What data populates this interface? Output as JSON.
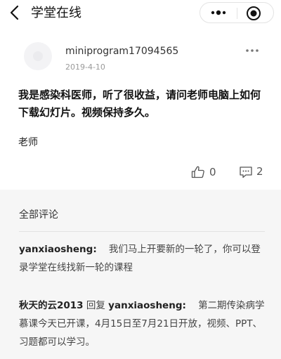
{
  "nav": {
    "title": "学堂在线"
  },
  "post": {
    "username": "miniprogram17094565",
    "date": "2019-4-10",
    "body": "我是感染科医师，听了很收益，请问老师电脑上如何下载幻灯片。视频保持多久。",
    "signature": "老师",
    "like_count": "0",
    "comment_count": "2"
  },
  "comments": {
    "header": "全部评论",
    "items": [
      {
        "author": "yanxiaosheng:",
        "text": "我们马上开要新的一轮了，你可以登录学堂在线找新一轮的课程"
      },
      {
        "author": "秋天的云2013",
        "reply_word": "回复",
        "reply_to": "yanxiaosheng:",
        "text": "第二期传染病学慕课今天已开课，4月15日至7月21日开放，视频、PPT、习题都可以学习。"
      }
    ]
  },
  "colors": {
    "background": "#ffffff",
    "comment_area": "#f6f6f6",
    "text_primary": "#111111",
    "text_secondary": "#9a9a9a"
  },
  "icons": {
    "back": "chevron-left-icon",
    "more": "more-dots-icon",
    "close": "target-icon",
    "like": "thumbs-up-icon",
    "comment": "comment-icon"
  }
}
